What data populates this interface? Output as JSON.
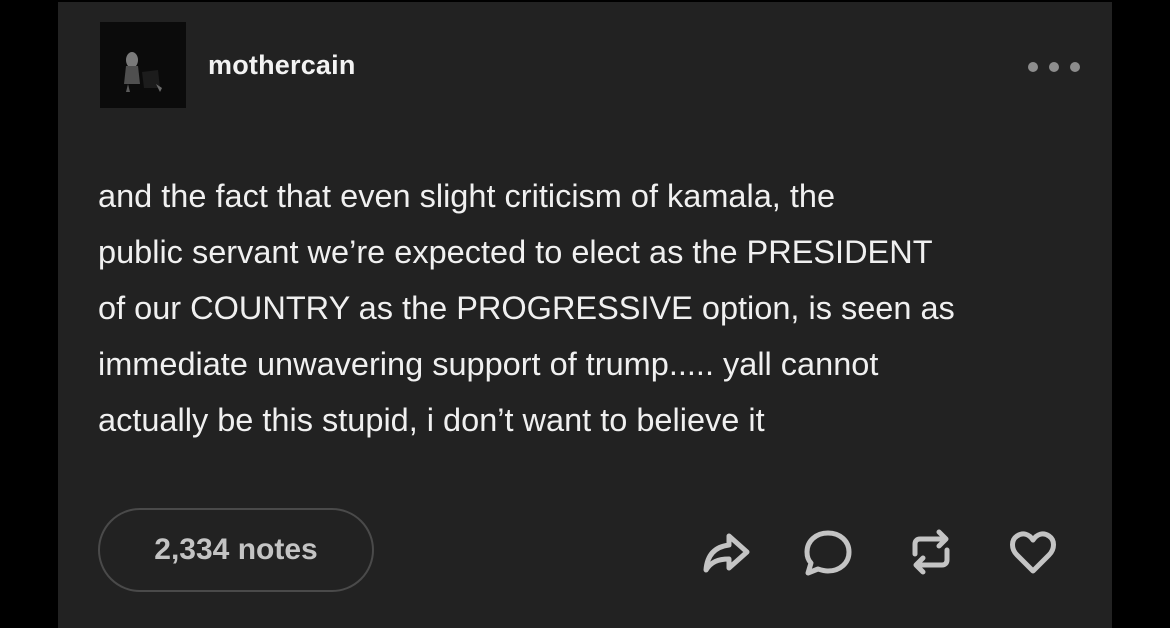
{
  "post": {
    "username": "mothercain",
    "body": "and the fact that even slight criticism of kamala, the\npublic servant we’re expected to elect as the PRESIDENT\nof our COUNTRY as the PROGRESSIVE option, is seen as\nimmediate unwavering support of trump..... yall cannot\nactually be this stupid, i don’t want to believe it",
    "notes_label": "2,334 notes"
  },
  "icons": {
    "more": "more-options-icon",
    "share": "share-icon",
    "reply": "reply-icon",
    "reblog": "reblog-icon",
    "like": "heart-icon"
  },
  "colors": {
    "background": "#000000",
    "card": "#222222",
    "text": "#f0f0f0",
    "muted": "#c4c4c4",
    "border": "#4a4a4a"
  }
}
